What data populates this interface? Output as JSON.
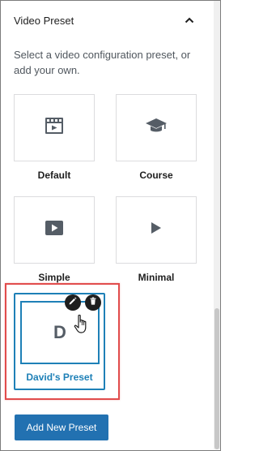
{
  "panel": {
    "title": "Video Preset",
    "description": "Select a video configuration preset, or add your own."
  },
  "presets": [
    {
      "label": "Default",
      "icon": "video-clapper-icon"
    },
    {
      "label": "Course",
      "icon": "graduation-cap-icon"
    },
    {
      "label": "Simple",
      "icon": "play-button-box-icon"
    },
    {
      "label": "Minimal",
      "icon": "play-triangle-icon"
    }
  ],
  "custom_preset": {
    "initial": "D",
    "label": "David's Preset",
    "actions": [
      "edit-pencil-icon",
      "delete-trash-icon"
    ]
  },
  "add_button": {
    "label": "Add New Preset"
  },
  "colors": {
    "accent": "#1e80b7",
    "button": "#2271b1",
    "highlight": "#e14c4c",
    "icon": "#555d66"
  }
}
